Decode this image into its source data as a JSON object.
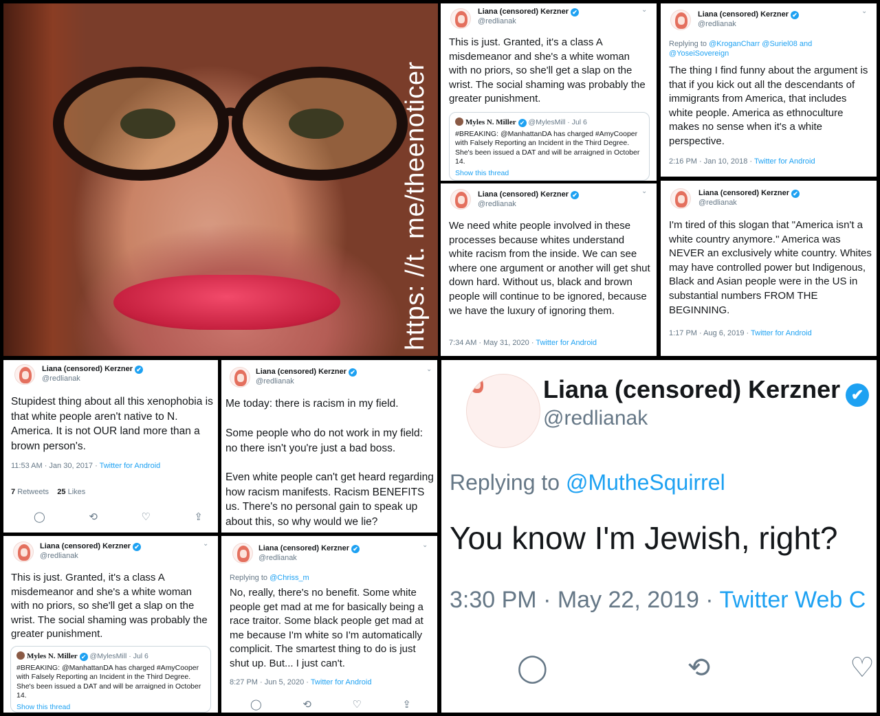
{
  "photo": {
    "overlay_text": "https: //t. me/theenoticer"
  },
  "account": {
    "name": "Liana (censored) Kerzner",
    "handle": "@redlianak"
  },
  "tweets": {
    "t1": {
      "body": "This is just. Granted, it's a class A misdemeanor and she's a white woman with no priors, so she'll get a slap on the wrist. The social shaming was probably the greater punishment.",
      "quote": {
        "name": "Myles N. Miller",
        "handle": "@MylesMill · Jul 6",
        "text": "#BREAKING: @ManhattanDA has charged #AmyCooper with Falsely Reporting an Incident in the Third Degree. She's been issued a DAT and will be arraigned in October 14.",
        "show_thread": "Show this thread"
      }
    },
    "t2": {
      "reply_prefix": "Replying to",
      "reply_mentions": "@KroganCharr @Suriel08 and @YoseiSovereign",
      "body": "The thing I find funny about the argument is that if you kick out all the descendants of immigrants from America, that includes white people. America as ethnoculture makes no sense when it's a white perspective.",
      "time": "2:16 PM · Jan 10, 2018 · ",
      "source": "Twitter for Android"
    },
    "t3": {
      "body": "We need white people involved in these processes because whites understand white racism from the inside. We can see where one argument or another will get shut down hard. Without us, black and brown people will continue to be ignored, because we have the luxury of ignoring them.",
      "time": "7:34 AM · May 31, 2020 · ",
      "source": "Twitter for Android"
    },
    "t4": {
      "body": "I'm tired of this slogan that \"America isn't a white country anymore.\" America was NEVER an exclusively white country. Whites may have controlled power but Indigenous, Black and Asian people were in the US in substantial numbers FROM THE BEGINNING.",
      "time": "1:17 PM · Aug 6, 2019 · ",
      "source": "Twitter for Android"
    },
    "t5": {
      "body": "Stupidest thing about all this xenophobia is that white people aren't native to N. America. It is not OUR land more than a brown person's.",
      "time": "11:53 AM · Jan 30, 2017 · ",
      "source": "Twitter for Android",
      "retweets_count": "7",
      "retweets_label": "Retweets",
      "likes_count": "25",
      "likes_label": "Likes"
    },
    "t6": {
      "p1": "Me today: there is racism in my field.",
      "p2": "Some people who do not work in my field: no there isn't you're just a bad boss.",
      "p3": "Even white people can't get heard regarding how racism manifests. Racism BENEFITS us. There's no personal gain to speak up about this, so why would we lie?"
    },
    "t8": {
      "reply_prefix": "Replying to",
      "reply_mentions": "@Chriss_m",
      "body": "No, really, there's no benefit. Some white people get mad at me for basically being a race traitor. Some black people get mad at me because I'm white so I'm automatically complicit. The smartest thing to do is just shut up. But... I just can't.",
      "time": "8:27 PM · Jun 5, 2020 · ",
      "source": "Twitter for Android"
    },
    "t9": {
      "reply_prefix": "Replying to",
      "reply_mentions": "@MutheSquirrel",
      "body": "You know I'm Jewish, right?",
      "time": "3:30 PM · May 22, 2019 · ",
      "source": "Twitter Web C"
    }
  },
  "icons": {
    "verified": "✔",
    "chevron": "⌄",
    "reply": "💬",
    "retweet": "⟲",
    "like": "♡",
    "share": "⇪"
  },
  "colors": {
    "link_blue": "#1da1f2",
    "muted_gray": "#657786",
    "background": "#000000"
  }
}
